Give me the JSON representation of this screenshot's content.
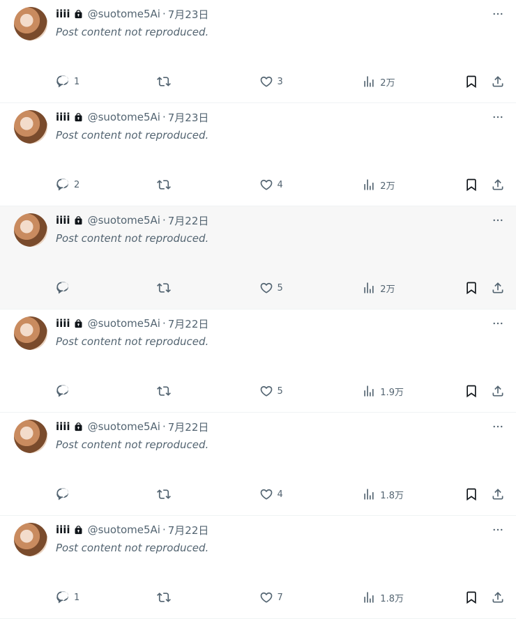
{
  "author": {
    "name": "iiii",
    "handle": "@suotome5Ai"
  },
  "placeholder_text": "Post content not reproduced.",
  "tweets": [
    {
      "date": "7月23日",
      "replies": "1",
      "retweets": "",
      "likes": "3",
      "views": "2万"
    },
    {
      "date": "7月23日",
      "replies": "2",
      "retweets": "",
      "likes": "4",
      "views": "2万"
    },
    {
      "date": "7月22日",
      "replies": "",
      "retweets": "",
      "likes": "5",
      "views": "2万"
    },
    {
      "date": "7月22日",
      "replies": "",
      "retweets": "",
      "likes": "5",
      "views": "1.9万"
    },
    {
      "date": "7月22日",
      "replies": "",
      "retweets": "",
      "likes": "4",
      "views": "1.8万"
    },
    {
      "date": "7月22日",
      "replies": "1",
      "retweets": "",
      "likes": "7",
      "views": "1.8万"
    }
  ],
  "icons": {
    "lock": "lock-icon",
    "more": "more-icon",
    "reply": "reply-icon",
    "retweet": "retweet-icon",
    "like": "heart-icon",
    "views": "views-icon",
    "bookmark": "bookmark-icon",
    "share": "share-icon"
  },
  "colors": {
    "text": "#0f1419",
    "muted": "#536471",
    "divider": "#eff3f4",
    "hover_bg": "#f7f7f7"
  }
}
